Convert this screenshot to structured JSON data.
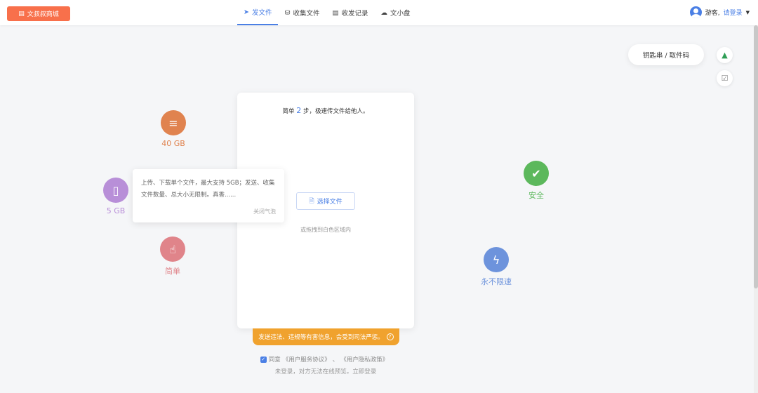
{
  "header": {
    "store_label": "文叔叔商城",
    "nav": [
      {
        "label": "发文件",
        "icon": "send-icon",
        "active": true
      },
      {
        "label": "收集文件",
        "icon": "collect-icon"
      },
      {
        "label": "收发记录",
        "icon": "record-icon"
      },
      {
        "label": "文小盘",
        "icon": "cloud-disk-icon"
      }
    ],
    "guest": "游客,",
    "login": "请登录"
  },
  "side": {
    "key_label": "钥匙串 / 取件码"
  },
  "features": [
    {
      "label": "40 GB",
      "color": "#e0834f"
    },
    {
      "label": "5 GB",
      "color": "#b88fd8"
    },
    {
      "label": "简单",
      "color": "#e0848a"
    },
    {
      "label": "安全",
      "color": "#5cb85c"
    },
    {
      "label": "永不限速",
      "color": "#6d93dc"
    }
  ],
  "tooltip": {
    "text": "上传、下载单个文件，最大支持 5GB；发送、收集文件数量、总大小无限制。真香......",
    "close": "关闭气泡"
  },
  "card": {
    "title_pre": "简单 ",
    "steps": "2",
    "title_post": " 步，极速传文件给他人。",
    "choose_label": "选择文件",
    "drag_hint": "或拖拽到白色区域内"
  },
  "warning": "发送违法、违规等有害信息，会受到司法严惩。",
  "agreement": {
    "agree": "同意",
    "terms": "《用户服务协议》",
    "sep": "、",
    "privacy": "《用户隐私政策》",
    "checked": true
  },
  "login_hint": "未登录，对方无法在线预览。立即登录"
}
